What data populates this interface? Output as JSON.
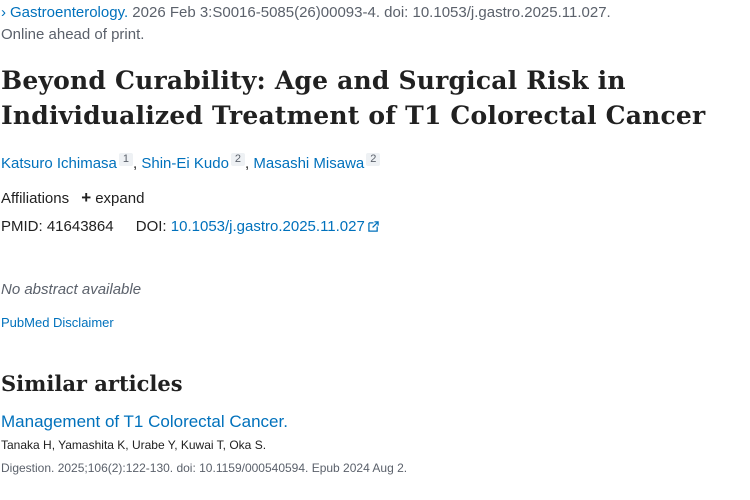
{
  "citation": {
    "arrow": "›",
    "journal": "Gastroenterology.",
    "details": " 2026 Feb 3:S0016-5085(26)00093-4. doi: 10.1053/j.gastro.2025.11.027.",
    "status": "Online ahead of print."
  },
  "article": {
    "title_line1": "Beyond Curability: Age and Surgical Risk in",
    "title_line2": "Individualized Treatment of T1 Colorectal Cancer"
  },
  "authors": [
    {
      "name": "Katsuro Ichimasa",
      "aff": "1"
    },
    {
      "name": "Shin-Ei Kudo",
      "aff": "2"
    },
    {
      "name": "Masashi Misawa",
      "aff": "2"
    }
  ],
  "affiliations": {
    "label": "Affiliations",
    "expand_label": "expand",
    "expand_icon": "plus-icon"
  },
  "ids": {
    "pmid_label": "PMID:",
    "pmid": "41643864",
    "doi_label": "DOI:",
    "doi": "10.1053/j.gastro.2025.11.027",
    "doi_icon": "external-link-icon"
  },
  "abstract": {
    "text": "No abstract available"
  },
  "disclaimer": {
    "label": "PubMed Disclaimer"
  },
  "similar": {
    "heading": "Similar articles",
    "items": [
      {
        "title": "Management of T1 Colorectal Cancer.",
        "authors": "Tanaka H, Yamashita K, Urabe Y, Kuwai T, Oka S.",
        "cite": "Digestion. 2025;106(2):122-130. doi: 10.1159/000540594. Epub 2024 Aug 2."
      }
    ]
  },
  "colors": {
    "link": "#0071bc",
    "text": "#212121",
    "muted": "#5b616b"
  }
}
